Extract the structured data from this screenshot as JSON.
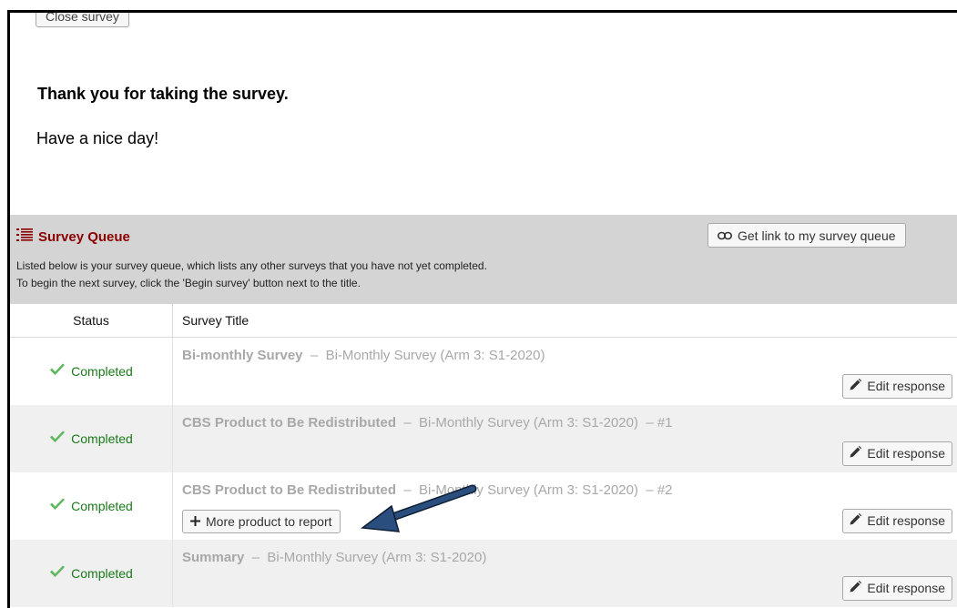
{
  "survey": {
    "close_button": "Close survey",
    "thanks_heading": "Thank you for taking the survey.",
    "closing_message": "Have a nice day!"
  },
  "queue": {
    "title": "Survey Queue",
    "desc_line1": "Listed below is your survey queue, which lists any other surveys that you have not yet completed.",
    "desc_line2": "To begin the next survey, click the 'Begin survey' button next to the title.",
    "link_button": "Get link to my survey queue",
    "col_status": "Status",
    "col_title": "Survey Title",
    "rows": [
      {
        "status": "Completed",
        "name": "Bi-monthly Survey",
        "separator": "–",
        "instrument": "Bi-Monthly Survey (Arm 3: S1-2020)",
        "instance": "",
        "edit_button": "Edit response"
      },
      {
        "status": "Completed",
        "name": "CBS Product to Be Redistributed",
        "separator": "–",
        "instrument": "Bi-Monthly Survey (Arm 3: S1-2020)",
        "instance": "– #1",
        "edit_button": "Edit response"
      },
      {
        "status": "Completed",
        "name": "CBS Product to Be Redistributed",
        "separator": "–",
        "instrument": "Bi-Monthly Survey (Arm 3: S1-2020)",
        "instance": "– #2",
        "more_button": "More product to report",
        "edit_button": "Edit response"
      },
      {
        "status": "Completed",
        "name": "Summary",
        "separator": "–",
        "instrument": "Bi-Monthly Survey (Arm 3: S1-2020)",
        "instance": "",
        "edit_button": "Edit response"
      }
    ]
  },
  "colors": {
    "queue_title": "#8b0000",
    "completed": "#1a7a1a",
    "check": "#5cb85c",
    "arrow": "#1f3f66",
    "header_bg": "#d4d4d4"
  },
  "icons": {
    "queue": "list-icon",
    "link": "link-icon",
    "check": "checkmark-icon",
    "edit": "pencil-icon",
    "plus": "plus-icon"
  }
}
